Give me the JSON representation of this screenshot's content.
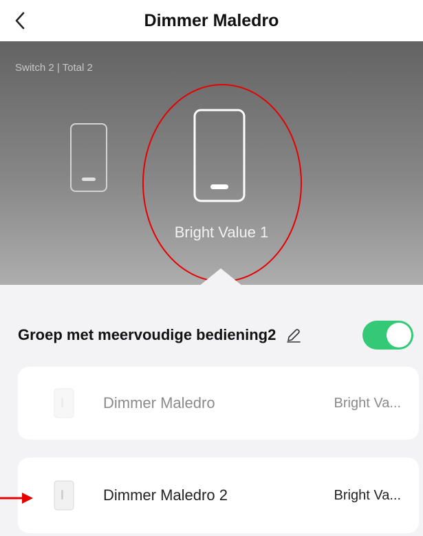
{
  "header": {
    "title": "Dimmer Maledro",
    "back_icon": "chevron-left-icon"
  },
  "hero": {
    "switch_info": "Switch 2 | Total 2",
    "selected_label": "Bright Value 1"
  },
  "group": {
    "title": "Groep met meervoudige bediening2",
    "edit_icon": "pencil-icon",
    "toggle_on": true,
    "toggle_color": "#33c977"
  },
  "devices": [
    {
      "name": "Dimmer Maledro",
      "value": "Bright Va..."
    },
    {
      "name": "Dimmer Maledro 2",
      "value": "Bright Va..."
    }
  ],
  "annotations": {
    "ring_color": "#e60000",
    "arrow_color": "#e60000"
  }
}
